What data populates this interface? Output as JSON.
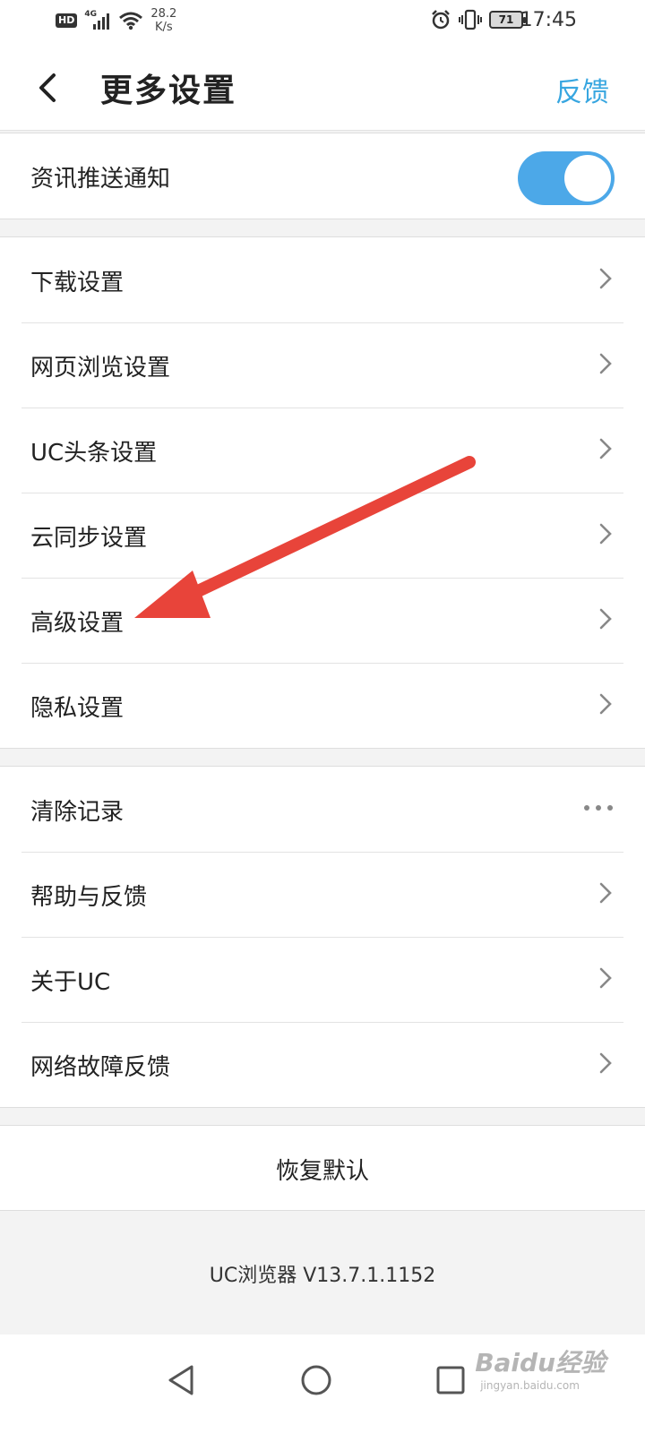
{
  "status_bar": {
    "hd": "HD",
    "network": "4G",
    "speed_value": "28.2",
    "speed_unit": "K/s",
    "battery": "71",
    "time": "17:45"
  },
  "header": {
    "title": "更多设置",
    "feedback": "反馈"
  },
  "news_push": {
    "label": "资讯推送通知",
    "enabled": true
  },
  "settings_group": [
    {
      "label": "下载设置"
    },
    {
      "label": "网页浏览设置"
    },
    {
      "label": "UC头条设置"
    },
    {
      "label": "云同步设置"
    },
    {
      "label": "高级设置"
    },
    {
      "label": "隐私设置"
    }
  ],
  "misc_group": [
    {
      "label": "清除记录",
      "action": "more-dots"
    },
    {
      "label": "帮助与反馈"
    },
    {
      "label": "关于UC"
    },
    {
      "label": "网络故障反馈"
    }
  ],
  "restore": "恢复默认",
  "version": "UC浏览器 V13.7.1.1152",
  "accent_color": "#37a6e0",
  "toggle_color": "#4ca8e8",
  "annotation_color": "#e8443a",
  "watermark": {
    "brand": "Baidu经验",
    "url": "jingyan.baidu.com"
  }
}
